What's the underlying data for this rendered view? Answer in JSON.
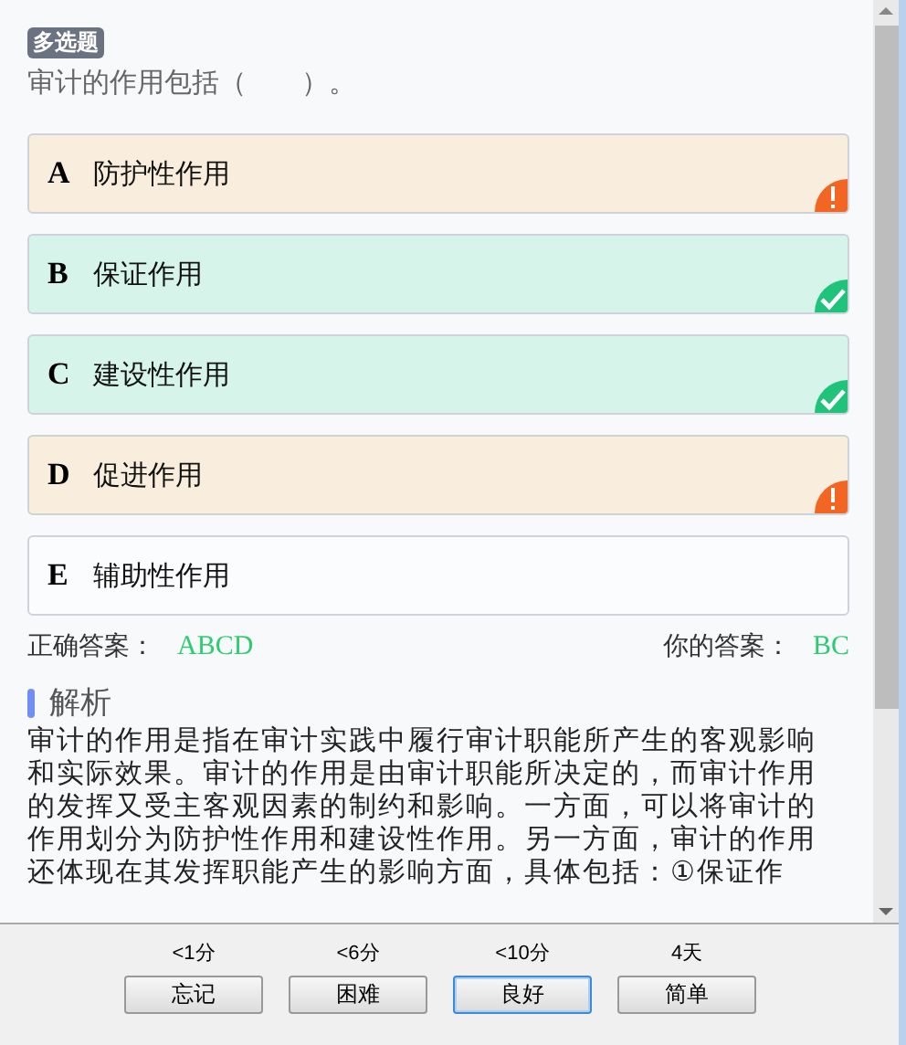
{
  "question": {
    "type_tag": "多选题",
    "stem": "审计的作用包括（　　）。"
  },
  "options": [
    {
      "letter": "A",
      "text": "防护性作用",
      "kind": "missed"
    },
    {
      "letter": "B",
      "text": "保证作用",
      "kind": "correct"
    },
    {
      "letter": "C",
      "text": "建设性作用",
      "kind": "correct"
    },
    {
      "letter": "D",
      "text": "促进作用",
      "kind": "missed"
    },
    {
      "letter": "E",
      "text": "辅助性作用",
      "kind": "plain"
    }
  ],
  "answers": {
    "correct_label": "正确答案：",
    "correct_value": "ABCD",
    "yours_label": "你的答案：",
    "yours_value": "BC"
  },
  "analysis": {
    "title": "解析",
    "body": "审计的作用是指在审计实践中履行审计职能所产生的客观影响和实际效果。审计的作用是由审计职能所决定的，而审计作用的发挥又受主客观因素的制约和影响。一方面，可以将审计的作用划分为防护性作用和建设性作用。另一方面，审计的作用还体现在其发挥职能产生的影响方面，具体包括：①保证作"
  },
  "ratings": [
    {
      "interval": "<1分",
      "label": "忘记",
      "selected": false
    },
    {
      "interval": "<6分",
      "label": "困难",
      "selected": false
    },
    {
      "interval": "<10分",
      "label": "良好",
      "selected": true
    },
    {
      "interval": "4天",
      "label": "简单",
      "selected": false
    }
  ]
}
